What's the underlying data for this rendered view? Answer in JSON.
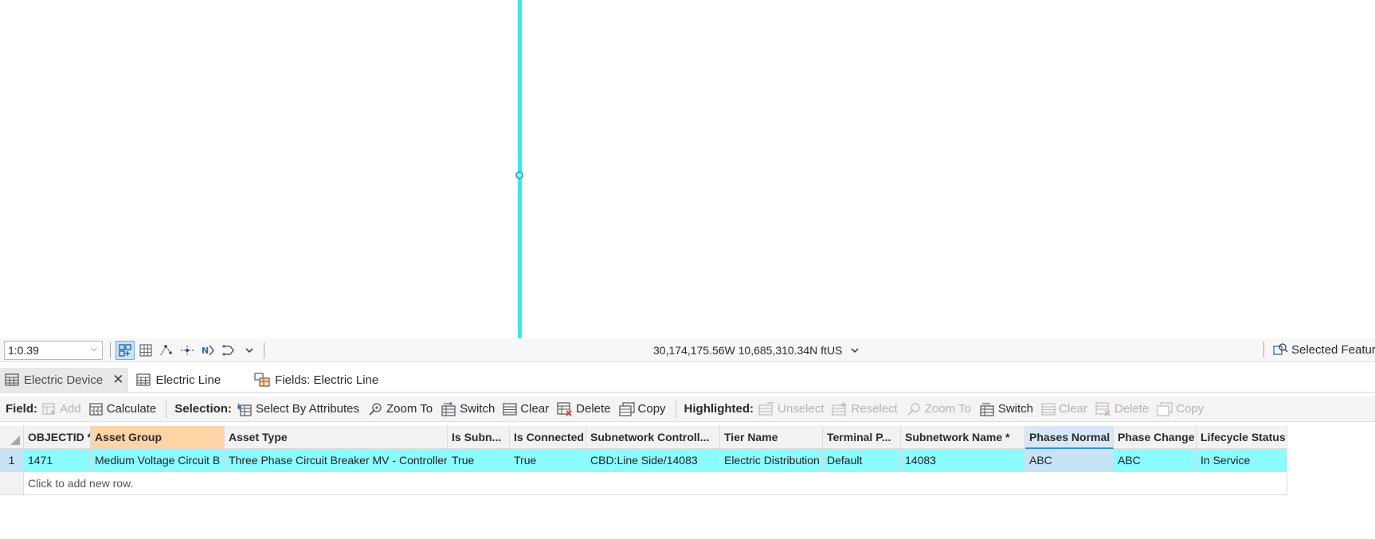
{
  "status_bar": {
    "scale_value": "1:0.39",
    "coordinates": "30,174,175.56W 10,685,310.34N ftUS",
    "selected_features_label": "Selected Feature"
  },
  "tabs": [
    {
      "label": "Electric Device"
    },
    {
      "label": "Electric Line"
    },
    {
      "label": "Fields: Electric Line"
    }
  ],
  "toolbar": {
    "field_label": "Field:",
    "add": "Add",
    "calculate": "Calculate",
    "selection_label": "Selection:",
    "select_by_attributes": "Select By Attributes",
    "zoom_to": "Zoom To",
    "switch": "Switch",
    "clear": "Clear",
    "delete": "Delete",
    "copy": "Copy",
    "highlighted_label": "Highlighted:",
    "unselect": "Unselect",
    "reselect": "Reselect",
    "h_zoom_to": "Zoom To",
    "h_switch": "Switch",
    "h_clear": "Clear",
    "h_delete": "Delete",
    "h_copy": "Copy"
  },
  "table": {
    "columns": [
      "OBJECTID *",
      "Asset Group",
      "Asset Type",
      "Is Subn...",
      "Is Connected",
      "Subnetwork Controll...",
      "Tier Name",
      "Terminal P...",
      "Subnetwork Name *",
      "Phases Normal",
      "Phase Change",
      "Lifecycle Status"
    ],
    "rows": [
      {
        "row_number": "1",
        "cells": [
          "1471",
          "Medium Voltage Circuit B",
          "Three Phase Circuit Breaker MV - Controller",
          "True",
          "True",
          "CBD:Line Side/14083",
          "Electric Distribution",
          "Default",
          "14083",
          "ABC",
          "ABC",
          "In Service"
        ]
      }
    ],
    "new_row_text": "Click to add new row."
  },
  "colors": {
    "selection_cyan": "#8afbff",
    "map_feature": "#35e8f0",
    "active_header": "#ffd4a6",
    "sorted_header": "#d6e8f7"
  }
}
